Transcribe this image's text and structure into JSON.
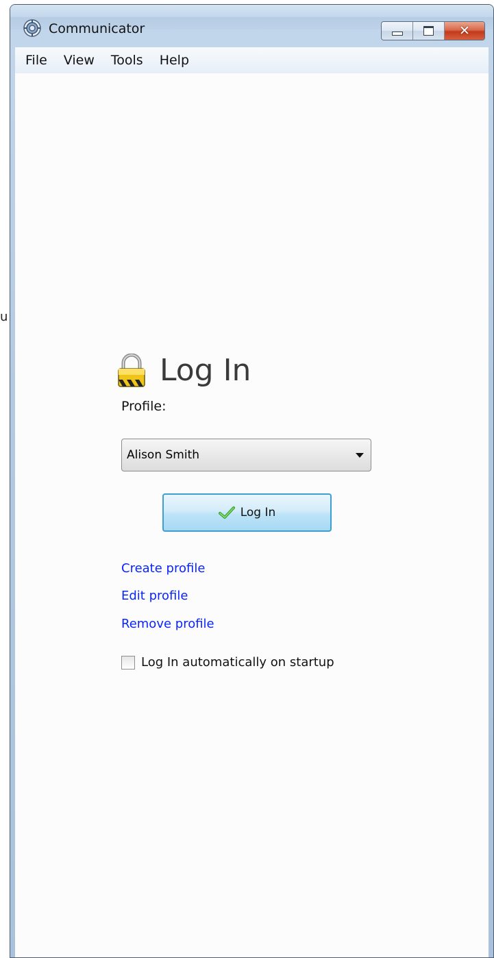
{
  "desktop": {
    "stray_text": "u"
  },
  "window": {
    "title": "Communicator",
    "app_icon": "communicator-gear-icon",
    "caption_buttons": {
      "minimize_icon": "minimize-icon",
      "maximize_icon": "maximize-icon",
      "close_icon": "close-icon",
      "close_glyph": "✕",
      "close_color": "#c63b1f"
    }
  },
  "menubar": {
    "items": [
      "File",
      "View",
      "Tools",
      "Help"
    ]
  },
  "login": {
    "icon": "padlock-icon",
    "title": "Log In",
    "profile_label": "Profile:",
    "profile_selected": "Alison Smith",
    "button_icon": "checkmark-icon",
    "button_label": "Log In",
    "links": [
      "Create profile",
      "Edit profile",
      "Remove profile"
    ],
    "link_color": "#0a24ff",
    "auto_login_label": "Log In automatically on startup",
    "auto_login_checked": false
  }
}
